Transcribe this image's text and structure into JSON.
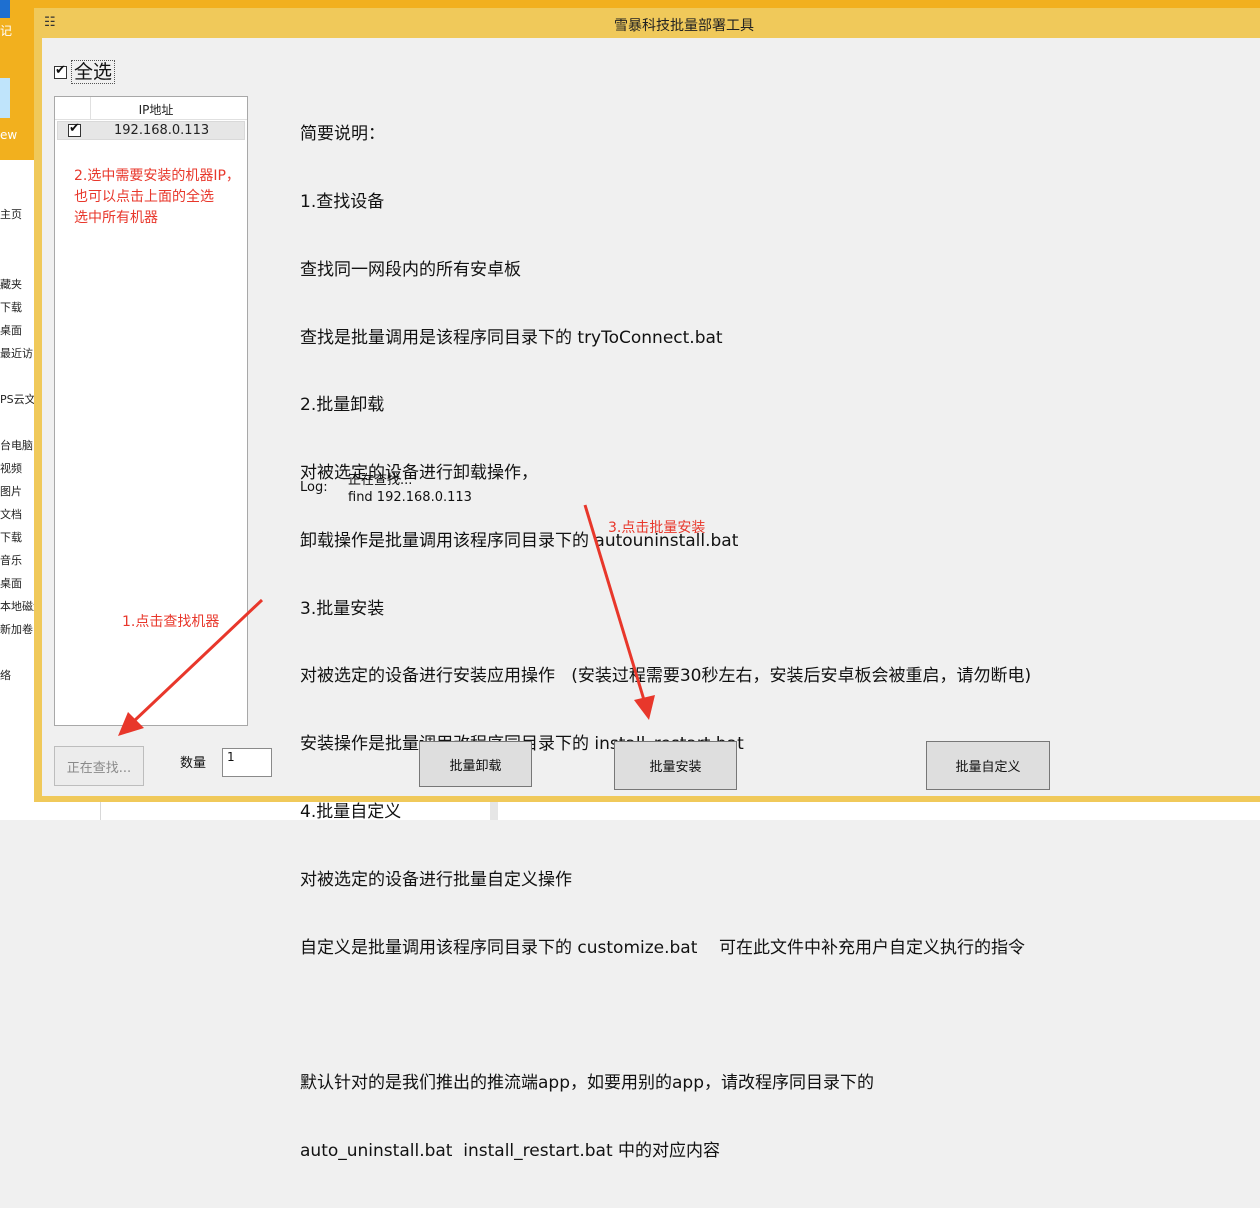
{
  "background": {
    "desktop_labels": [
      "记",
      "ew"
    ],
    "explorer_items": [
      "主页",
      "藏夹",
      "下载",
      "桌面",
      "最近访问",
      "PS云文",
      "台电脑",
      "视频",
      "图片",
      "文档",
      "下载",
      "音乐",
      "桌面",
      "本地磁盘",
      "新加卷",
      "络"
    ]
  },
  "window": {
    "title": "雪暴科技批量部署工具"
  },
  "select_all": {
    "label": "全选",
    "checked": true
  },
  "ip_list": {
    "header": "IP地址",
    "rows": [
      {
        "ip": "192.168.0.113",
        "checked": true
      }
    ]
  },
  "annotations": {
    "step1": "1.点击查找机器",
    "step2_line1": "2.选中需要安装的机器IP，",
    "step2_line2": "也可以点击上面的全选",
    "step2_line3": "选中所有机器",
    "step3": "3.点击批量安装",
    "color": "#e8372b"
  },
  "description": {
    "lines": [
      "简要说明：",
      "1.查找设备",
      "查找同一网段内的所有安卓板",
      "查找是批量调用是该程序同目录下的 tryToConnect.bat",
      "2.批量卸载",
      "对被选定的设备进行卸载操作，",
      "卸载操作是批量调用该程序同目录下的 autouninstall.bat",
      "3.批量安装",
      "对被选定的设备进行安装应用操作   (安装过程需要30秒左右，安装后安卓板会被重启，请勿断电)",
      "安装操作是批量调用改程序同目录下的 install_restart.bat",
      "4.批量自定义",
      "对被选定的设备进行批量自定义操作",
      "自定义是批量调用该程序同目录下的 customize.bat    可在此文件中补充用户自定义执行的指令",
      "",
      "默认针对的是我们推出的推流端app，如要用别的app，请改程序同目录下的",
      "auto_uninstall.bat  install_restart.bat 中的对应内容"
    ]
  },
  "log": {
    "label": "Log:",
    "line1": "正在查找...",
    "line2": "find 192.168.0.113"
  },
  "controls": {
    "find_button": "正在查找...",
    "quantity_label": "数量",
    "quantity_value": "1",
    "uninstall_button": "批量卸载",
    "install_button": "批量安装",
    "custom_button": "批量自定义"
  }
}
